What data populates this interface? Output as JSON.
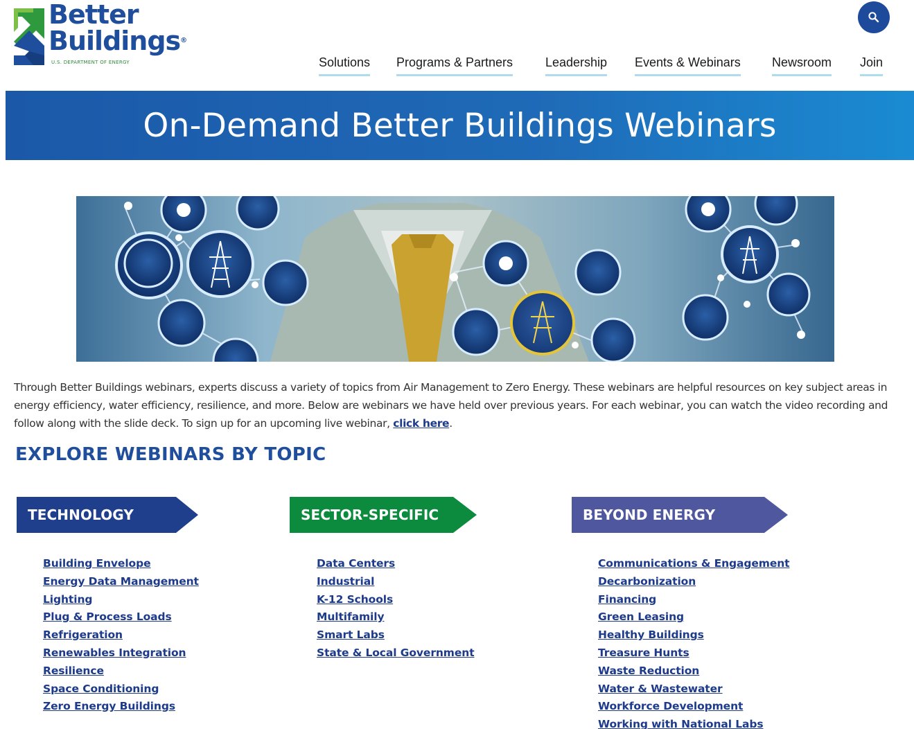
{
  "header": {
    "logo": {
      "line1": "Better",
      "line2": "Buildings",
      "registered": "®",
      "subtitle": "U.S. DEPARTMENT OF ENERGY"
    },
    "search_icon": "search-icon",
    "nav": [
      "Solutions",
      "Programs & Partners",
      "Leadership",
      "Events & Webinars",
      "Newsroom",
      "Join"
    ]
  },
  "page": {
    "title": "On-Demand Better Buildings Webinars"
  },
  "intro": {
    "text": "Through Better Buildings webinars, experts discuss a variety of topics from Air Management to Zero Energy. These webinars are helpful resources on key subject areas in energy efficiency, water efficiency, resilience, and more. Below are webinars we have held over previous years. For each webinar, you can watch the video recording and follow along with the slide deck. To sign up for an upcoming live webinar, ",
    "link": "click here",
    "end": "."
  },
  "explore_heading": "EXPLORE WEBINARS BY TOPIC",
  "topics": [
    {
      "title": "TECHNOLOGY",
      "color": "#1f3f8d",
      "items": [
        "Building Envelope",
        "Energy Data Management",
        "Lighting",
        "Plug & Process Loads",
        "Refrigeration",
        "Renewables Integration",
        "Resilience",
        "Space Conditioning",
        "Zero Energy Buildings"
      ]
    },
    {
      "title": "SECTOR-SPECIFIC",
      "color": "#0c8a3e",
      "items": [
        "Data Centers",
        "Industrial",
        "K-12 Schools",
        "Multifamily",
        "Smart Labs",
        "State & Local Government"
      ]
    },
    {
      "title": "BEYOND ENERGY",
      "color": "#4f589f",
      "items": [
        "Communications & Engagement",
        "Decarbonization",
        "Financing",
        "Green Leasing",
        "Healthy Buildings",
        "Treasure Hunts",
        "Waste Reduction",
        "Water & Wastewater",
        "Workforce Development",
        "Working with National Labs"
      ]
    }
  ]
}
